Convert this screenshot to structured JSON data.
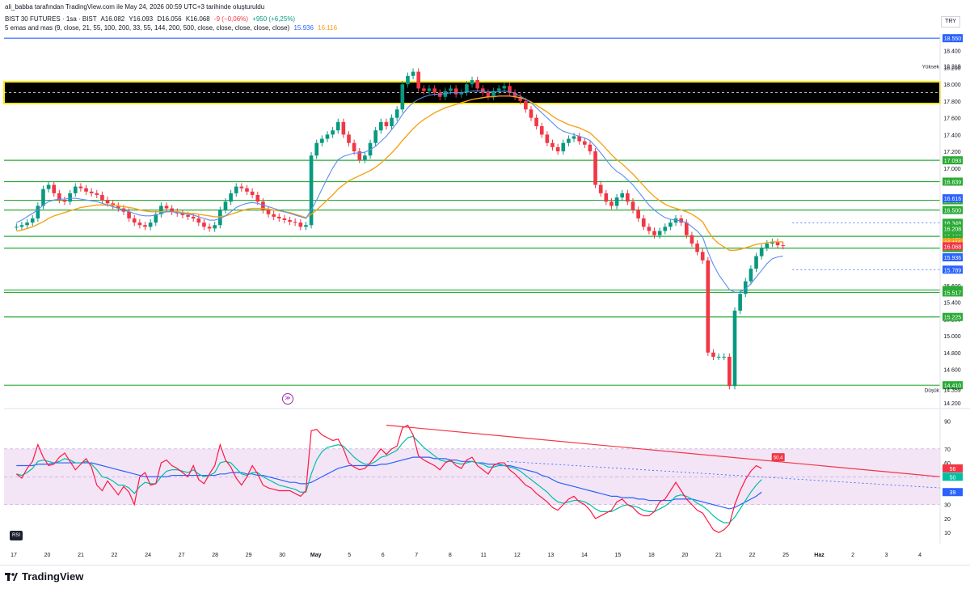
{
  "header": {
    "author_line": "ali_babba tarafından TradingView.com ile May 24, 2026 00:59 UTC+3 tarihinde oluşturuldu",
    "symbol": "BIST 30 FUTURES · 1sa · BIST",
    "ohlc": {
      "open": "A16.082",
      "high": "Y16.093",
      "low": "D16.056",
      "close": "K16.068",
      "change": "-9 (−0,06%)",
      "volume": "+950 (+6,25%)"
    },
    "indicator": "5 emas and mas (9, close, 21, 55, 100, 200, 33, 55, 144, 200, 500, close, close, close, close, close)",
    "indicator_values": [
      "15.936",
      "16.116"
    ],
    "currency": "TRY",
    "oscillator_label": "RSI"
  },
  "footer": {
    "brand": "TradingView"
  },
  "colors": {
    "up": "#089981",
    "down": "#f23645",
    "ema_fast": "#5b8def",
    "ema_slow": "#f7a21b",
    "level": "#2bab36",
    "top_level": "#2962ff",
    "zone": "#000000",
    "zone_border": "#ffeb00",
    "rsi_band": "#f3e5f5",
    "rsi_line": "#ff1744",
    "rsi_signal": "#00bfa5",
    "rsi_ma": "#2962ff"
  },
  "chart_data": {
    "type": "candlestick",
    "title": "BIST 30 FUTURES · 1sa · BIST",
    "price_axis": {
      "ticks": [
        18.4,
        18.2,
        18.0,
        17.8,
        17.6,
        17.4,
        17.2,
        17.0,
        15.6,
        15.4,
        15.2,
        15.0,
        14.8,
        14.6,
        14.4,
        14.2
      ],
      "ylim": [
        14.18,
        18.6
      ]
    },
    "time_axis": {
      "labels": [
        "17",
        "20",
        "21",
        "22",
        "24",
        "27",
        "28",
        "29",
        "30",
        "May",
        "5",
        "6",
        "7",
        "8",
        "11",
        "12",
        "13",
        "14",
        "15",
        "18",
        "20",
        "21",
        "22",
        "25",
        "Haz",
        "2",
        "3",
        "4"
      ],
      "xlim": [
        0,
        27.6
      ]
    },
    "levels": [
      {
        "label": "18.550",
        "value": 18.55,
        "color": "#2962ff"
      },
      {
        "label": "17.093",
        "value": 17.093,
        "color": "#2bab36"
      },
      {
        "label": "16.839",
        "value": 16.839,
        "color": "#2bab36"
      },
      {
        "label": "16.616",
        "value": 16.616,
        "color": "#2bab36"
      },
      {
        "label": "16.500",
        "value": 16.5,
        "color": "#2bab36"
      },
      {
        "label": "16.186",
        "value": 16.186,
        "color": "#2bab36"
      },
      {
        "label": "16.045",
        "value": 16.045,
        "color": "#2bab36"
      },
      {
        "label": "15.546",
        "value": 15.546,
        "color": "#2bab36"
      },
      {
        "label": "15.517",
        "value": 15.517,
        "color": "#2bab36"
      },
      {
        "label": "15.225",
        "value": 15.225,
        "color": "#2bab36"
      },
      {
        "label": "14.410",
        "value": 14.41,
        "color": "#2bab36"
      }
    ],
    "extra_labels": [
      {
        "label": "16.616",
        "value": 16.64,
        "color": "#2962ff"
      },
      {
        "label": "16.348",
        "value": 16.348,
        "color": "#2bab36"
      },
      {
        "label": "16.208",
        "value": 16.28,
        "color": "#2bab36"
      },
      {
        "label": "16.150",
        "value": 16.15,
        "color": "#2bab36"
      },
      {
        "label": "16.116",
        "value": 16.116,
        "color": "#f7a21b"
      },
      {
        "label": "16.068",
        "value": 16.068,
        "color": "#f23645"
      },
      {
        "label": "15.936",
        "value": 15.936,
        "color": "#2962ff"
      },
      {
        "label": "15.789",
        "value": 15.789,
        "color": "#2962ff"
      }
    ],
    "high_marker": {
      "label": "Yüksek",
      "value": "18.219"
    },
    "low_marker": {
      "label": "Düşük",
      "value": "14.359"
    },
    "dotted_levels": [
      16.348,
      15.789
    ],
    "zone": {
      "from": 17.77,
      "to": 18.03,
      "mid": 17.9
    },
    "candles_close": [
      16.3,
      16.32,
      16.35,
      16.4,
      16.55,
      16.75,
      16.8,
      16.7,
      16.62,
      16.6,
      16.7,
      16.78,
      16.76,
      16.72,
      16.7,
      16.68,
      16.62,
      16.58,
      16.55,
      16.52,
      16.48,
      16.4,
      16.35,
      16.32,
      16.3,
      16.35,
      16.45,
      16.55,
      16.52,
      16.48,
      16.46,
      16.44,
      16.42,
      16.4,
      16.35,
      16.3,
      16.28,
      16.32,
      16.5,
      16.6,
      16.7,
      16.78,
      16.76,
      16.72,
      16.68,
      16.6,
      16.5,
      16.45,
      16.42,
      16.4,
      16.38,
      16.36,
      16.35,
      16.3,
      16.32,
      17.15,
      17.3,
      17.35,
      17.4,
      17.45,
      17.55,
      17.4,
      17.3,
      17.2,
      17.1,
      17.15,
      17.3,
      17.45,
      17.55,
      17.5,
      17.6,
      17.7,
      18.0,
      18.1,
      18.15,
      17.95,
      17.92,
      17.95,
      17.9,
      17.85,
      17.92,
      17.95,
      17.88,
      17.9,
      18.0,
      18.05,
      17.95,
      17.9,
      17.85,
      17.92,
      17.95,
      17.98,
      17.9,
      17.85,
      17.8,
      17.7,
      17.6,
      17.5,
      17.4,
      17.3,
      17.25,
      17.2,
      17.3,
      17.35,
      17.38,
      17.32,
      17.28,
      17.2,
      16.8,
      16.7,
      16.6,
      16.55,
      16.65,
      16.7,
      16.6,
      16.5,
      16.4,
      16.3,
      16.25,
      16.2,
      16.25,
      16.3,
      16.35,
      16.4,
      16.35,
      16.2,
      16.1,
      16.0,
      15.9,
      14.8,
      14.75,
      14.75,
      14.75,
      14.4,
      15.3,
      15.5,
      15.65,
      15.8,
      15.95,
      16.05,
      16.1,
      16.12,
      16.08,
      16.07
    ],
    "ema_fast": [
      16.35,
      16.38,
      16.42,
      16.46,
      16.5,
      16.56,
      16.6,
      16.62,
      16.63,
      16.63,
      16.64,
      16.64,
      16.63,
      16.62,
      16.61,
      16.6,
      16.58,
      16.56,
      16.54,
      16.52,
      16.5,
      16.48,
      16.46,
      16.44,
      16.43,
      16.43,
      16.44,
      16.46,
      16.48,
      16.48,
      16.47,
      16.46,
      16.45,
      16.44,
      16.42,
      16.4,
      16.38,
      16.38,
      16.4,
      16.43,
      16.48,
      16.53,
      16.56,
      16.58,
      16.59,
      16.58,
      16.56,
      16.54,
      16.52,
      16.5,
      16.48,
      16.46,
      16.44,
      16.42,
      16.4,
      16.5,
      16.62,
      16.75,
      16.88,
      17.0,
      17.1,
      17.14,
      17.16,
      17.18,
      17.18,
      17.19,
      17.22,
      17.26,
      17.32,
      17.38,
      17.46,
      17.54,
      17.64,
      17.72,
      17.78,
      17.82,
      17.85,
      17.87,
      17.88,
      17.88,
      17.89,
      17.9,
      17.9,
      17.9,
      17.91,
      17.92,
      17.92,
      17.92,
      17.91,
      17.91,
      17.91,
      17.92,
      17.91,
      17.89,
      17.86,
      17.82,
      17.78,
      17.72,
      17.66,
      17.6,
      17.54,
      17.48,
      17.44,
      17.42,
      17.4,
      17.38,
      17.36,
      17.33,
      17.26,
      17.18,
      17.1,
      17.02,
      16.96,
      16.92,
      16.86,
      16.8,
      16.72,
      16.64,
      16.56,
      16.5,
      16.45,
      16.41,
      16.39,
      16.38,
      16.37,
      16.35,
      16.3,
      16.25,
      16.18,
      16.0,
      15.85,
      15.73,
      15.64,
      15.55,
      15.52,
      15.52,
      15.56,
      15.62,
      15.7,
      15.78,
      15.86,
      15.92,
      15.94,
      15.95
    ],
    "ema_slow": [
      16.25,
      16.26,
      16.28,
      16.3,
      16.33,
      16.36,
      16.4,
      16.43,
      16.45,
      16.47,
      16.49,
      16.51,
      16.53,
      16.54,
      16.55,
      16.56,
      16.56,
      16.56,
      16.56,
      16.55,
      16.54,
      16.53,
      16.52,
      16.5,
      16.49,
      16.48,
      16.48,
      16.48,
      16.48,
      16.48,
      16.48,
      16.47,
      16.46,
      16.46,
      16.45,
      16.44,
      16.43,
      16.42,
      16.42,
      16.43,
      16.45,
      16.47,
      16.49,
      16.51,
      16.52,
      16.52,
      16.52,
      16.51,
      16.5,
      16.49,
      16.48,
      16.47,
      16.45,
      16.43,
      16.41,
      16.45,
      16.5,
      16.56,
      16.62,
      16.68,
      16.75,
      16.8,
      16.85,
      16.88,
      16.91,
      16.94,
      16.97,
      17.01,
      17.06,
      17.12,
      17.18,
      17.25,
      17.33,
      17.4,
      17.47,
      17.53,
      17.58,
      17.62,
      17.66,
      17.69,
      17.72,
      17.74,
      17.76,
      17.78,
      17.8,
      17.82,
      17.83,
      17.84,
      17.85,
      17.85,
      17.86,
      17.86,
      17.86,
      17.85,
      17.84,
      17.82,
      17.79,
      17.75,
      17.71,
      17.67,
      17.62,
      17.58,
      17.55,
      17.52,
      17.5,
      17.48,
      17.45,
      17.42,
      17.36,
      17.3,
      17.23,
      17.16,
      17.1,
      17.05,
      16.99,
      16.93,
      16.86,
      16.79,
      16.72,
      16.66,
      16.61,
      16.57,
      16.54,
      16.52,
      16.5,
      16.48,
      16.45,
      16.41,
      16.36,
      16.25,
      16.16,
      16.1,
      16.06,
      16.02,
      16.02,
      16.03,
      16.05,
      16.07,
      16.09,
      16.1,
      16.11,
      16.12,
      16.12,
      16.12
    ],
    "rsi": {
      "name": "RSI",
      "axis_ticks": [
        90,
        70,
        60,
        50,
        40,
        30,
        20,
        10
      ],
      "ylim": [
        2,
        96
      ],
      "band": [
        30,
        70
      ],
      "labels": [
        {
          "label": "56",
          "value": 56,
          "color": "#f23645"
        },
        {
          "label": "50",
          "value": 50,
          "color": "#00bfa5"
        },
        {
          "label": "39",
          "value": 39,
          "color": "#2962ff"
        }
      ],
      "value_badge": "50.4",
      "trend_line": [
        [
          11.1,
          87
        ],
        [
          27.6,
          50
        ]
      ],
      "dotted_line": [
        [
          14.7,
          61
        ],
        [
          27.6,
          42
        ]
      ],
      "main": [
        52,
        49,
        56,
        61,
        73,
        64,
        58,
        59,
        64,
        67,
        61,
        55,
        59,
        63,
        57,
        44,
        40,
        47,
        42,
        37,
        43,
        39,
        30,
        50,
        53,
        44,
        45,
        60,
        62,
        58,
        56,
        53,
        50,
        58,
        48,
        45,
        52,
        58,
        73,
        62,
        57,
        49,
        44,
        50,
        58,
        52,
        44,
        42,
        41,
        40,
        40,
        40,
        38,
        36,
        40,
        83,
        84,
        80,
        78,
        76,
        77,
        70,
        60,
        57,
        55,
        56,
        60,
        65,
        70,
        66,
        70,
        72,
        85,
        87,
        80,
        65,
        62,
        60,
        58,
        55,
        60,
        62,
        58,
        56,
        62,
        64,
        58,
        55,
        52,
        58,
        60,
        60,
        55,
        52,
        48,
        44,
        42,
        38,
        35,
        32,
        28,
        26,
        30,
        34,
        36,
        32,
        30,
        26,
        20,
        22,
        24,
        26,
        32,
        34,
        30,
        28,
        24,
        22,
        22,
        25,
        32,
        34,
        40,
        46,
        40,
        34,
        30,
        26,
        24,
        18,
        12,
        10,
        12,
        16,
        30,
        40,
        48,
        54,
        58,
        56
      ],
      "signal": [
        52,
        51,
        53,
        56,
        61,
        62,
        61,
        60,
        61,
        63,
        62,
        60,
        60,
        61,
        59,
        55,
        50,
        49,
        47,
        44,
        44,
        42,
        38,
        43,
        46,
        45,
        45,
        50,
        54,
        55,
        55,
        54,
        53,
        55,
        52,
        50,
        51,
        53,
        60,
        61,
        60,
        56,
        52,
        51,
        53,
        53,
        50,
        48,
        46,
        44,
        43,
        42,
        41,
        39,
        39,
        52,
        62,
        68,
        71,
        72,
        73,
        72,
        68,
        64,
        61,
        59,
        59,
        61,
        64,
        65,
        67,
        69,
        74,
        78,
        79,
        75,
        71,
        68,
        65,
        62,
        61,
        61,
        60,
        59,
        60,
        61,
        60,
        59,
        57,
        57,
        58,
        58,
        57,
        56,
        54,
        51,
        48,
        45,
        42,
        39,
        35,
        32,
        31,
        32,
        33,
        33,
        32,
        30,
        27,
        25,
        25,
        25,
        27,
        29,
        30,
        29,
        28,
        26,
        25,
        25,
        27,
        29,
        32,
        36,
        37,
        36,
        34,
        31,
        29,
        26,
        22,
        19,
        17,
        17,
        21,
        27,
        33,
        39,
        44,
        48
      ],
      "ma": [
        58,
        58,
        58,
        58,
        59,
        59,
        59,
        60,
        60,
        60,
        60,
        60,
        60,
        60,
        60,
        59,
        58,
        57,
        56,
        55,
        54,
        53,
        52,
        51,
        50,
        50,
        50,
        50,
        50,
        51,
        51,
        51,
        51,
        51,
        51,
        51,
        51,
        51,
        52,
        52,
        53,
        53,
        53,
        52,
        52,
        51,
        51,
        50,
        49,
        48,
        47,
        46,
        46,
        45,
        45,
        46,
        48,
        50,
        52,
        54,
        56,
        57,
        58,
        58,
        58,
        58,
        58,
        58,
        59,
        59,
        60,
        61,
        62,
        63,
        64,
        64,
        64,
        64,
        63,
        63,
        63,
        62,
        62,
        61,
        61,
        61,
        60,
        60,
        59,
        59,
        59,
        58,
        58,
        57,
        56,
        55,
        54,
        53,
        51,
        50,
        48,
        46,
        45,
        44,
        43,
        42,
        41,
        40,
        39,
        38,
        37,
        36,
        36,
        35,
        35,
        35,
        34,
        34,
        33,
        33,
        33,
        33,
        33,
        34,
        34,
        34,
        34,
        33,
        32,
        31,
        30,
        29,
        28,
        27,
        28,
        30,
        32,
        34,
        36,
        39
      ]
    }
  }
}
